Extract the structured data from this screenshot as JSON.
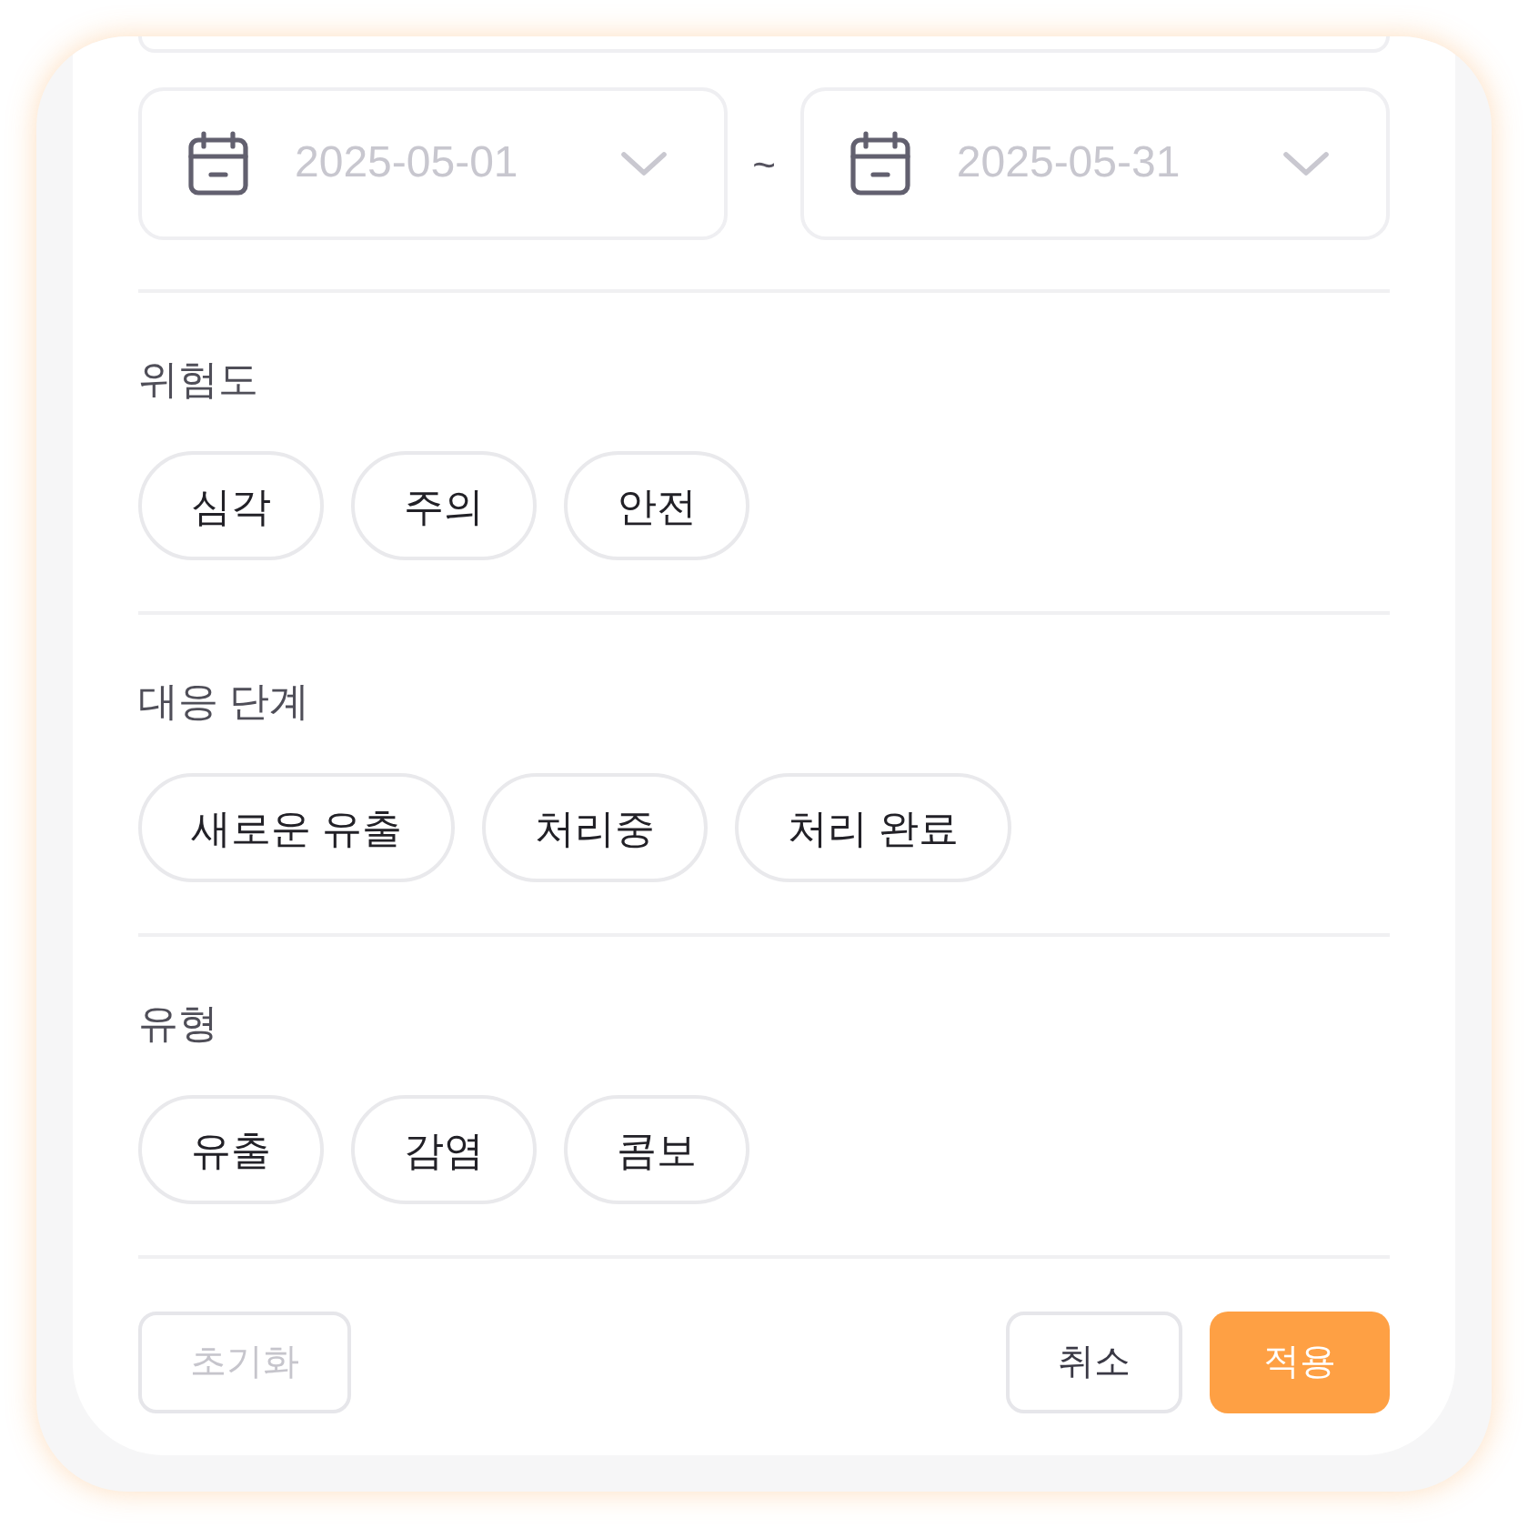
{
  "date_range": {
    "start": {
      "value": "2025-05-01"
    },
    "separator": "~",
    "end": {
      "value": "2025-05-31"
    }
  },
  "sections": [
    {
      "title": "위험도",
      "chips": [
        {
          "label": "심각",
          "selected": false
        },
        {
          "label": "주의",
          "selected": false
        },
        {
          "label": "안전",
          "selected": false
        }
      ]
    },
    {
      "title": "대응 단계",
      "chips": [
        {
          "label": "새로운 유출",
          "selected": false
        },
        {
          "label": "처리중",
          "selected": false
        },
        {
          "label": "처리 완료",
          "selected": false
        }
      ]
    },
    {
      "title": "유형",
      "chips": [
        {
          "label": "유출",
          "selected": false
        },
        {
          "label": "감염",
          "selected": false
        },
        {
          "label": "콤보",
          "selected": false
        }
      ]
    }
  ],
  "buttons": [
    {
      "kind": "reset",
      "label": "초기화",
      "disabled": true
    },
    {
      "kind": "cancel",
      "label": "취소",
      "disabled": false
    },
    {
      "kind": "apply",
      "label": "적용",
      "disabled": false
    }
  ]
}
